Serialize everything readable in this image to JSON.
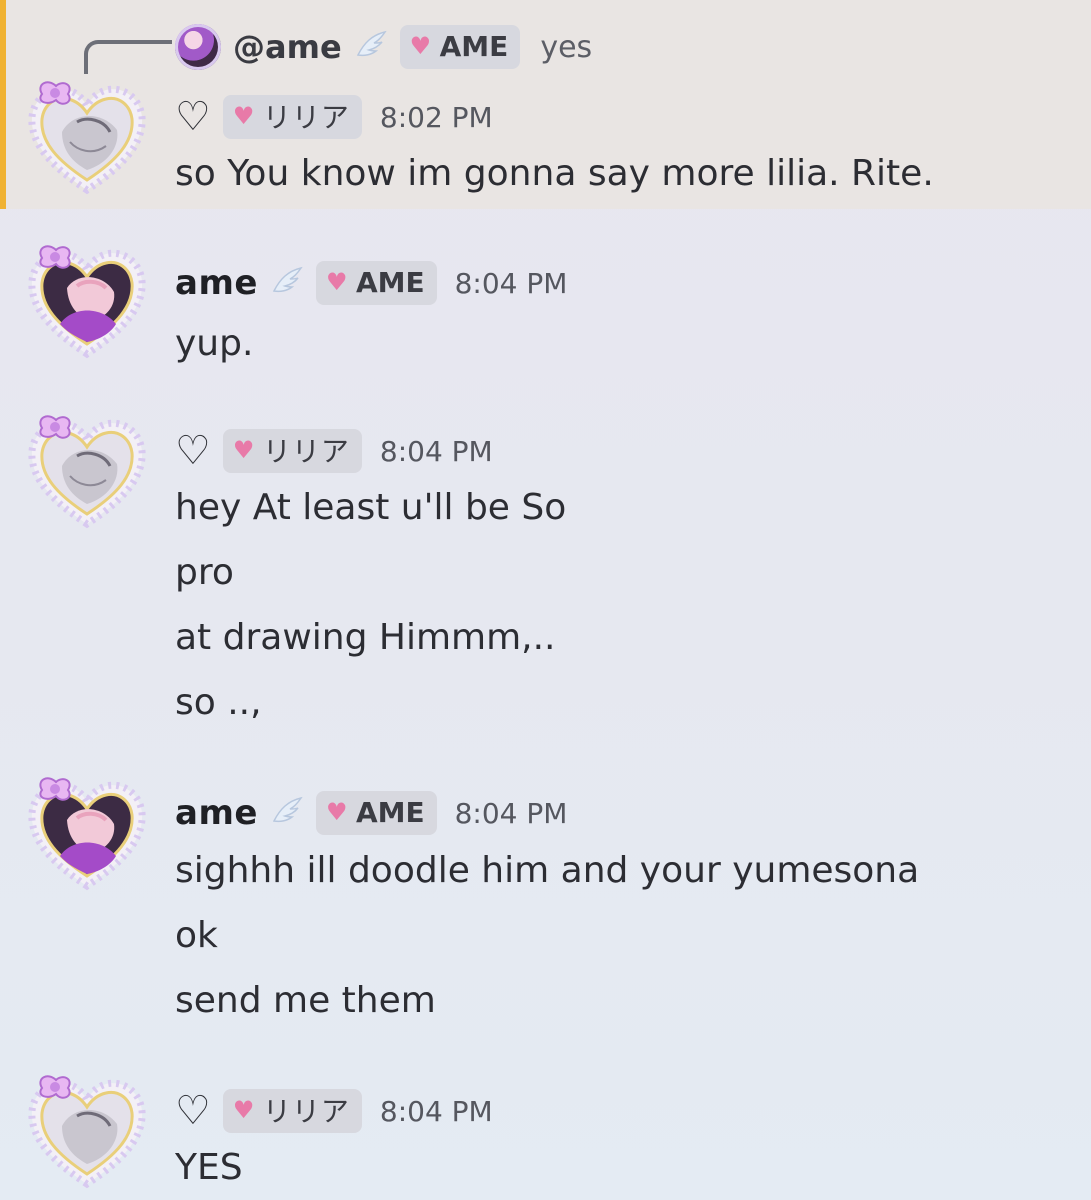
{
  "reply": {
    "author": "@ame",
    "author_badge_icon": "angel-wing-icon",
    "tag": "AME",
    "text": "yes"
  },
  "messages": [
    {
      "author_type": "liliа",
      "name": "♡",
      "tag": "リリア",
      "time": "8:02 PM",
      "lines": [
        "so You know im gonna say more lilia. Rite."
      ]
    },
    {
      "author_type": "ame",
      "name": "ame",
      "tag": "AME",
      "time": "8:04 PM",
      "lines": [
        "yup."
      ]
    },
    {
      "author_type": "lilia",
      "name": "♡",
      "tag": "リリア",
      "time": "8:04 PM",
      "lines": [
        "hey At least u'll be So",
        "pro",
        "at drawing Himmm,..",
        "so ..,"
      ]
    },
    {
      "author_type": "ame",
      "name": "ame",
      "tag": "AME",
      "time": "8:04 PM",
      "lines": [
        "sighhh ill doodle him and your yumesona",
        "ok",
        "send me them"
      ]
    },
    {
      "author_type": "lilia",
      "name": "♡",
      "tag": "リリア",
      "time": "8:04 PM",
      "lines": [
        "YES"
      ]
    }
  ],
  "colors": {
    "highlight_bar": "#f0b232",
    "tag_heart": "#e87aa8",
    "avatar_frame": "#cfc2ee"
  }
}
